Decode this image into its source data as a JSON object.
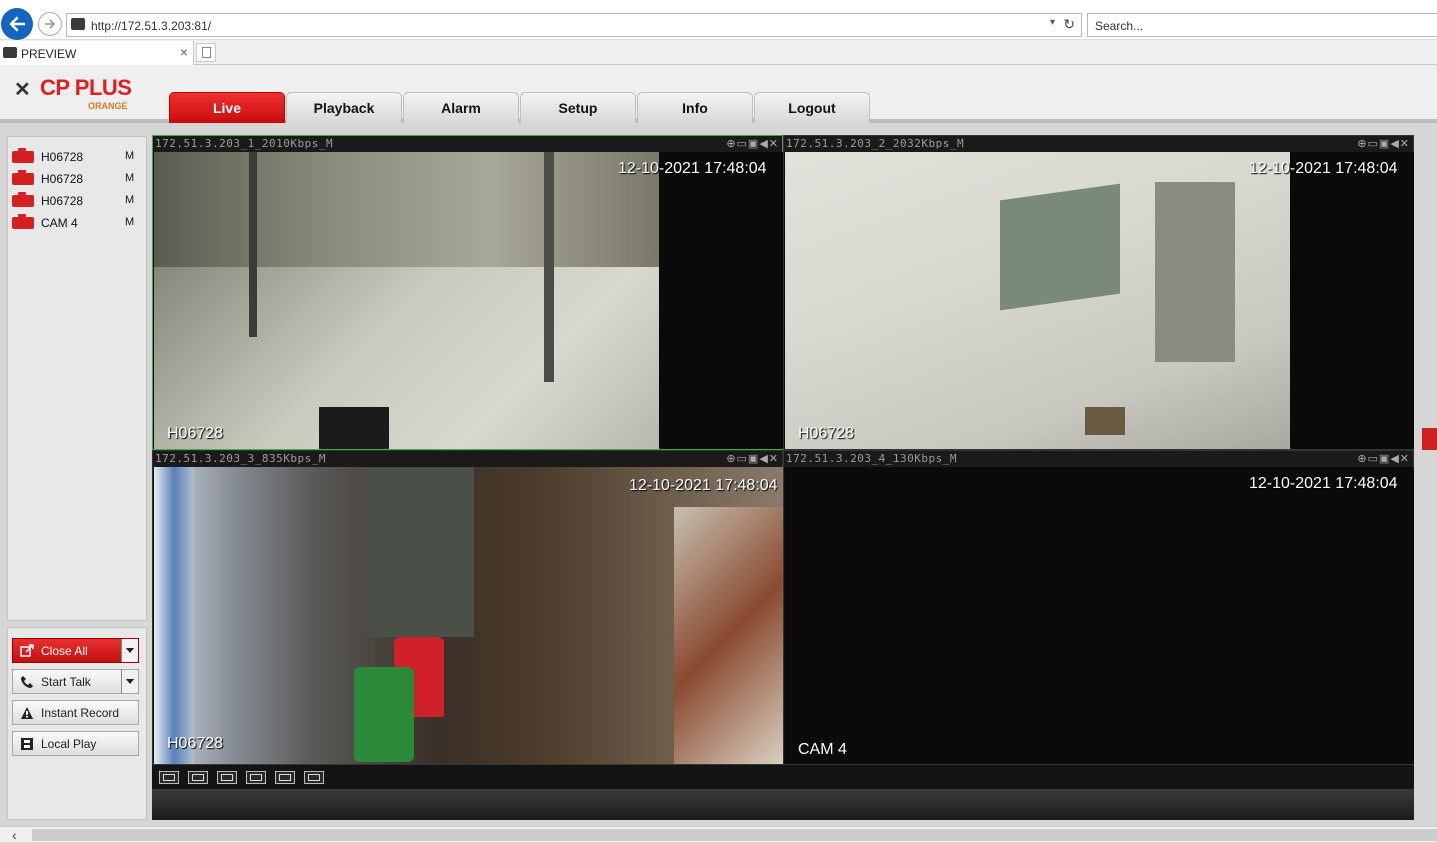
{
  "browser": {
    "url": "http://172.51.3.203:81/",
    "search_placeholder": "Search...",
    "tab_title": "PREVIEW",
    "tab_close": "×"
  },
  "app": {
    "logo_main": "CP PLUS",
    "logo_sub": "ORANGE",
    "nav": [
      "Live",
      "Playback",
      "Alarm",
      "Setup",
      "Info",
      "Logout"
    ],
    "active_nav": "Live"
  },
  "cameras": [
    {
      "name": "H06728",
      "mode": "M"
    },
    {
      "name": "H06728",
      "mode": "M"
    },
    {
      "name": "H06728",
      "mode": "M"
    },
    {
      "name": "CAM 4",
      "mode": "M"
    }
  ],
  "controls": {
    "close_all": "Close All",
    "start_talk": "Start Talk",
    "instant_record": "Instant Record",
    "local_play": "Local Play"
  },
  "panes": [
    {
      "title": "172.51.3.203_1_2010Kbps_M",
      "time": "12-10-2021 17:48:04",
      "name": "H06728"
    },
    {
      "title": "172.51.3.203_2_2032Kbps_M",
      "time": "12-10-2021 17:48:04",
      "name": "H06728"
    },
    {
      "title": "172.51.3.203_3_835Kbps_M",
      "time": "12-10-2021 17:48:04",
      "name": "H06728"
    },
    {
      "title": "172.51.3.203_4_130Kbps_M",
      "time": "12-10-2021 17:48:04",
      "name": "CAM 4"
    }
  ],
  "colors": {
    "accent": "#d42020",
    "selected_border": "#3ab03a"
  }
}
